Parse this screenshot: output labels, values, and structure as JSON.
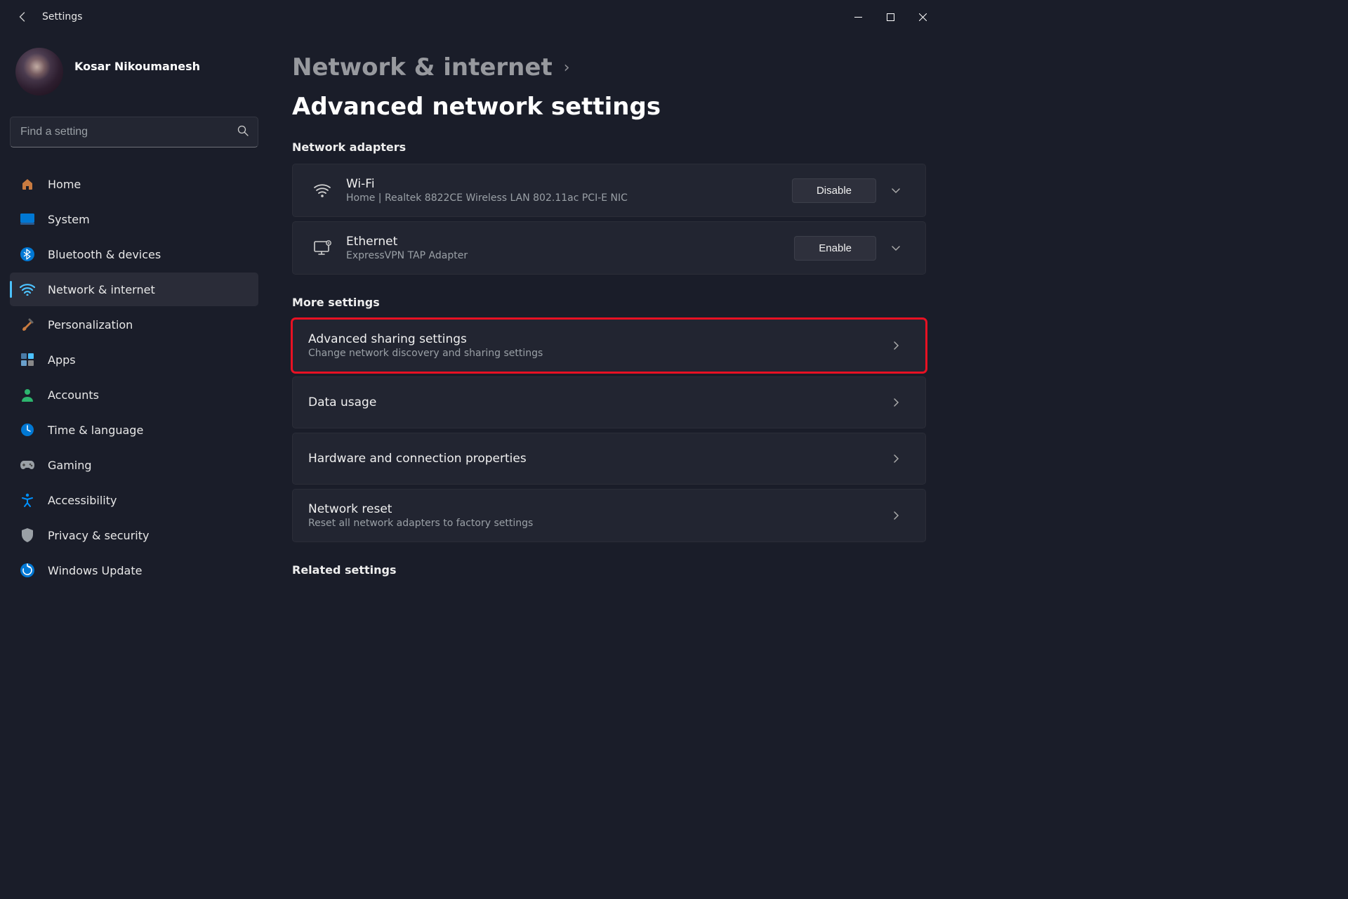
{
  "window": {
    "title": "Settings"
  },
  "user": {
    "name": "Kosar Nikoumanesh"
  },
  "search": {
    "placeholder": "Find a setting"
  },
  "sidebar": {
    "items": [
      {
        "label": "Home"
      },
      {
        "label": "System"
      },
      {
        "label": "Bluetooth & devices"
      },
      {
        "label": "Network & internet"
      },
      {
        "label": "Personalization"
      },
      {
        "label": "Apps"
      },
      {
        "label": "Accounts"
      },
      {
        "label": "Time & language"
      },
      {
        "label": "Gaming"
      },
      {
        "label": "Accessibility"
      },
      {
        "label": "Privacy & security"
      },
      {
        "label": "Windows Update"
      }
    ]
  },
  "breadcrumb": {
    "parent": "Network & internet",
    "current": "Advanced network settings"
  },
  "sections": {
    "adapters_title": "Network adapters",
    "adapters": [
      {
        "title": "Wi-Fi",
        "sub": "Home | Realtek 8822CE Wireless LAN 802.11ac PCI-E NIC",
        "btn": "Disable"
      },
      {
        "title": "Ethernet",
        "sub": "ExpressVPN TAP Adapter",
        "btn": "Enable"
      }
    ],
    "more_title": "More settings",
    "more": [
      {
        "title": "Advanced sharing settings",
        "sub": "Change network discovery and sharing settings"
      },
      {
        "title": "Data usage",
        "sub": ""
      },
      {
        "title": "Hardware and connection properties",
        "sub": ""
      },
      {
        "title": "Network reset",
        "sub": "Reset all network adapters to factory settings"
      }
    ],
    "related_title": "Related settings"
  }
}
